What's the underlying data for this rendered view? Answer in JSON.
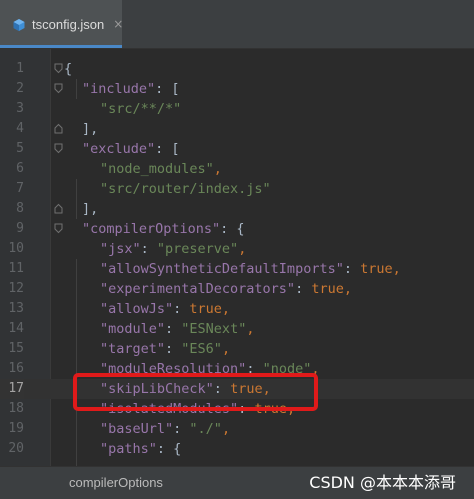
{
  "tab": {
    "icon": "typescript-config-icon",
    "label": "tsconfig.json",
    "close_glyph": "×"
  },
  "editor": {
    "lines": [
      {
        "num": "1",
        "tokens": [
          [
            "punc",
            "{"
          ]
        ]
      },
      {
        "num": "2",
        "tokens": [
          [
            "key",
            "\"include\""
          ],
          [
            "punc",
            ": ["
          ]
        ]
      },
      {
        "num": "3",
        "tokens": [
          [
            "str",
            "\"src/**/*\""
          ]
        ]
      },
      {
        "num": "4",
        "tokens": [
          [
            "punc",
            "],"
          ]
        ]
      },
      {
        "num": "5",
        "tokens": [
          [
            "key",
            "\"exclude\""
          ],
          [
            "punc",
            ": ["
          ]
        ]
      },
      {
        "num": "6",
        "tokens": [
          [
            "str",
            "\"node_modules\""
          ],
          [
            "kw",
            ","
          ]
        ]
      },
      {
        "num": "7",
        "tokens": [
          [
            "str",
            "\"src/router/index.js\""
          ]
        ]
      },
      {
        "num": "8",
        "tokens": [
          [
            "punc",
            "],"
          ]
        ]
      },
      {
        "num": "9",
        "tokens": [
          [
            "key",
            "\"compilerOptions\""
          ],
          [
            "punc",
            ": {"
          ]
        ]
      },
      {
        "num": "10",
        "tokens": [
          [
            "key",
            "\"jsx\""
          ],
          [
            "punc",
            ": "
          ],
          [
            "str",
            "\"preserve\""
          ],
          [
            "kw",
            ","
          ]
        ]
      },
      {
        "num": "11",
        "tokens": [
          [
            "key",
            "\"allowSyntheticDefaultImports\""
          ],
          [
            "punc",
            ": "
          ],
          [
            "kw",
            "true,"
          ]
        ]
      },
      {
        "num": "12",
        "tokens": [
          [
            "key",
            "\"experimentalDecorators\""
          ],
          [
            "punc",
            ": "
          ],
          [
            "kw",
            "true,"
          ]
        ]
      },
      {
        "num": "13",
        "tokens": [
          [
            "key",
            "\"allowJs\""
          ],
          [
            "punc",
            ": "
          ],
          [
            "kw",
            "true,"
          ]
        ]
      },
      {
        "num": "14",
        "tokens": [
          [
            "key",
            "\"module\""
          ],
          [
            "punc",
            ": "
          ],
          [
            "str",
            "\"ESNext\""
          ],
          [
            "kw",
            ","
          ]
        ]
      },
      {
        "num": "15",
        "tokens": [
          [
            "key",
            "\"target\""
          ],
          [
            "punc",
            ": "
          ],
          [
            "str",
            "\"ES6\""
          ],
          [
            "kw",
            ","
          ]
        ]
      },
      {
        "num": "16",
        "tokens": [
          [
            "key",
            "\"moduleResolution\""
          ],
          [
            "punc",
            ": "
          ],
          [
            "str",
            "\"node\""
          ],
          [
            "kw",
            ","
          ]
        ]
      },
      {
        "num": "17",
        "tokens": [
          [
            "key",
            "\"skipLibCheck\""
          ],
          [
            "punc",
            ": "
          ],
          [
            "kw",
            "true,"
          ]
        ]
      },
      {
        "num": "18",
        "tokens": [
          [
            "key",
            "\"isolatedModules\""
          ],
          [
            "punc",
            ": "
          ],
          [
            "kw",
            "true,"
          ]
        ]
      },
      {
        "num": "19",
        "tokens": [
          [
            "key",
            "\"baseUrl\""
          ],
          [
            "punc",
            ": "
          ],
          [
            "str",
            "\"./\""
          ],
          [
            "kw",
            ","
          ]
        ]
      },
      {
        "num": "20",
        "tokens": [
          [
            "key",
            "\"paths\""
          ],
          [
            "punc",
            ": {"
          ]
        ]
      }
    ]
  },
  "breadcrumb": {
    "path": "compilerOptions"
  },
  "watermark": "CSDN @本本本添哥",
  "colors": {
    "key": "#9876aa",
    "string": "#6a8759",
    "keyword": "#cc7832",
    "annotation_box": "#e01a1a",
    "tab_accent": "#4a88c7"
  }
}
